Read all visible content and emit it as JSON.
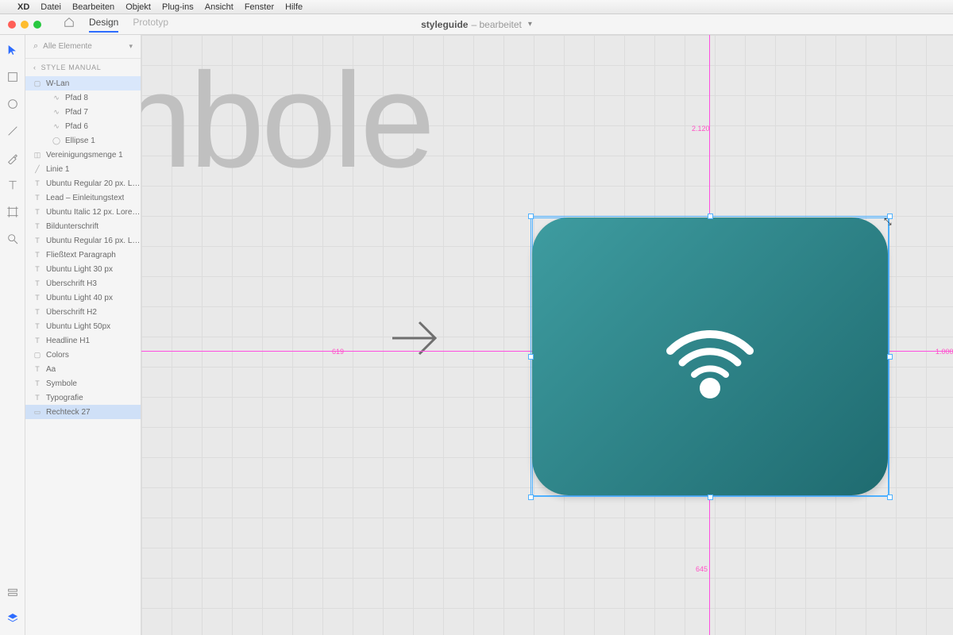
{
  "menu": {
    "apple": "",
    "app": "XD",
    "items": [
      "Datei",
      "Bearbeiten",
      "Objekt",
      "Plug-ins",
      "Ansicht",
      "Fenster",
      "Hilfe"
    ]
  },
  "toolbar": {
    "tabs": {
      "design": "Design",
      "prototype": "Prototyp"
    },
    "doc_name": "styleguide",
    "doc_state": "– bearbeitet"
  },
  "layers": {
    "search_placeholder": "Alle Elemente",
    "back_label": "STYLE MANUAL",
    "items": [
      {
        "label": "W-Lan",
        "icon": "folder",
        "lvl": 0,
        "sel": true
      },
      {
        "label": "Pfad 8",
        "icon": "path",
        "lvl": 2
      },
      {
        "label": "Pfad 7",
        "icon": "path",
        "lvl": 2
      },
      {
        "label": "Pfad 6",
        "icon": "path",
        "lvl": 2
      },
      {
        "label": "Ellipse 1",
        "icon": "ellipse",
        "lvl": 2
      },
      {
        "label": "Vereinigungsmenge 1",
        "icon": "combine",
        "lvl": 0
      },
      {
        "label": "Linie 1",
        "icon": "line",
        "lvl": 0
      },
      {
        "label": "Ubuntu Regular 20 px. Lor…",
        "icon": "text",
        "lvl": 0
      },
      {
        "label": "Lead – Einleitungstext",
        "icon": "text",
        "lvl": 0
      },
      {
        "label": "Ubuntu Italic 12 px. Lorem…",
        "icon": "text",
        "lvl": 0
      },
      {
        "label": "Bildunterschrift",
        "icon": "text",
        "lvl": 0
      },
      {
        "label": "Ubuntu Regular 16 px. Lor…",
        "icon": "text",
        "lvl": 0
      },
      {
        "label": "Fließtext Paragraph",
        "icon": "text",
        "lvl": 0
      },
      {
        "label": "Ubuntu Light 30 px",
        "icon": "text",
        "lvl": 0
      },
      {
        "label": "Überschrift H3",
        "icon": "text",
        "lvl": 0
      },
      {
        "label": "Ubuntu Light 40 px",
        "icon": "text",
        "lvl": 0
      },
      {
        "label": "Überschrift H2",
        "icon": "text",
        "lvl": 0
      },
      {
        "label": "Ubuntu Light 50px",
        "icon": "text",
        "lvl": 0
      },
      {
        "label": "Headline H1",
        "icon": "text",
        "lvl": 0
      },
      {
        "label": "Colors",
        "icon": "folder",
        "lvl": 0
      },
      {
        "label": "Aa",
        "icon": "text",
        "lvl": 0
      },
      {
        "label": "Symbole",
        "icon": "text",
        "lvl": 0
      },
      {
        "label": "Typografie",
        "icon": "text",
        "lvl": 0
      },
      {
        "label": "Rechteck 27",
        "icon": "rect",
        "lvl": 0,
        "sel": true
      }
    ]
  },
  "canvas": {
    "big_text": "nbole",
    "guides": {
      "g1": "619",
      "g2": "2.120",
      "g3": "1.000",
      "g4": "645"
    }
  }
}
